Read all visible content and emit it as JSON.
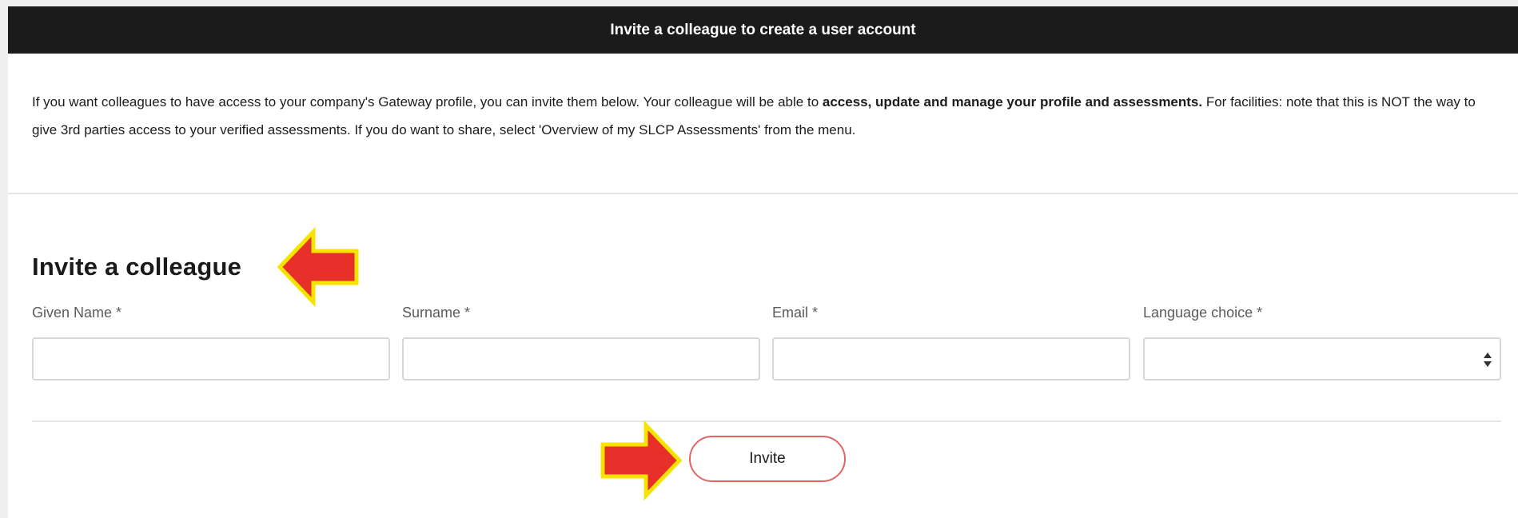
{
  "header": {
    "title": "Invite a colleague to create a user account"
  },
  "intro": {
    "text_part1": "If you want colleagues to have access to your company's Gateway profile, you can invite them below. Your colleague will be able to ",
    "text_bold": "access, update and manage your profile and assessments.",
    "text_part2": " For facilities: note that this is NOT the way to give 3rd parties access to your verified assessments. If you do want to share, select 'Overview of my SLCP Assessments' from the menu."
  },
  "form": {
    "title": "Invite a colleague",
    "given_name_label": "Given Name *",
    "given_name_value": "",
    "surname_label": "Surname *",
    "surname_value": "",
    "email_label": "Email *",
    "email_value": "",
    "language_label": "Language choice *",
    "language_value": "",
    "invite_label": "Invite"
  },
  "icons": {
    "annotation_arrow": "red-arrow-icon",
    "select_chevron": "updown-chevron-icon"
  },
  "colors": {
    "header_bg": "#1c1b1b",
    "button_border": "#e26464",
    "arrow_fill": "#e8302a",
    "arrow_outline": "#f5e400"
  }
}
